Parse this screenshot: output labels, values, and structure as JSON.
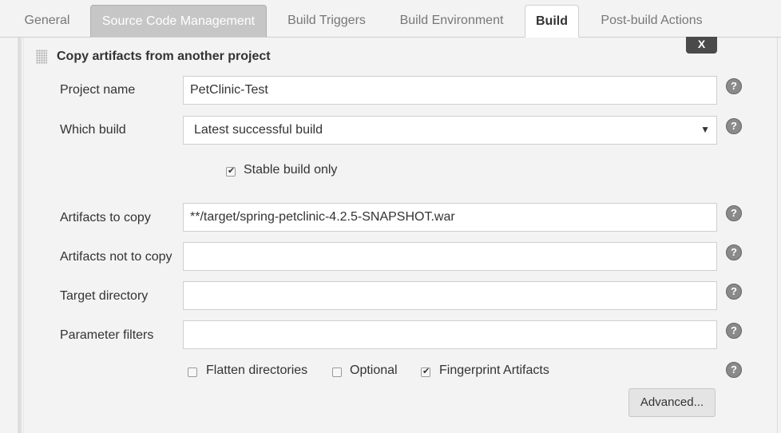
{
  "tabs": [
    {
      "label": "General",
      "state": "normal"
    },
    {
      "label": "Source Code Management",
      "state": "hover"
    },
    {
      "label": "Build Triggers",
      "state": "normal"
    },
    {
      "label": "Build Environment",
      "state": "normal"
    },
    {
      "label": "Build",
      "state": "active"
    },
    {
      "label": "Post-build Actions",
      "state": "normal"
    }
  ],
  "section": {
    "title": "Copy artifacts from another project",
    "delete_label": "X"
  },
  "form": {
    "project_name": {
      "label": "Project name",
      "value": "PetClinic-Test"
    },
    "which_build": {
      "label": "Which build",
      "value": "Latest successful build"
    },
    "stable_only": {
      "label": "Stable build only",
      "checked": true
    },
    "artifacts_to_copy": {
      "label": "Artifacts to copy",
      "value": "**/target/spring-petclinic-4.2.5-SNAPSHOT.war"
    },
    "artifacts_not_to_copy": {
      "label": "Artifacts not to copy",
      "value": ""
    },
    "target_directory": {
      "label": "Target directory",
      "value": ""
    },
    "parameter_filters": {
      "label": "Parameter filters",
      "value": ""
    },
    "flatten": {
      "label": "Flatten directories",
      "checked": false
    },
    "optional": {
      "label": "Optional",
      "checked": false
    },
    "fingerprint": {
      "label": "Fingerprint Artifacts",
      "checked": true
    },
    "advanced_label": "Advanced..."
  },
  "help_icon_glyph": "?",
  "colors": {
    "active_tab_bg": "#ffffff",
    "hover_tab_bg": "#c6c6c6",
    "delete_button_bg": "#4a4a4a",
    "page_bg": "#f3f3f3"
  }
}
